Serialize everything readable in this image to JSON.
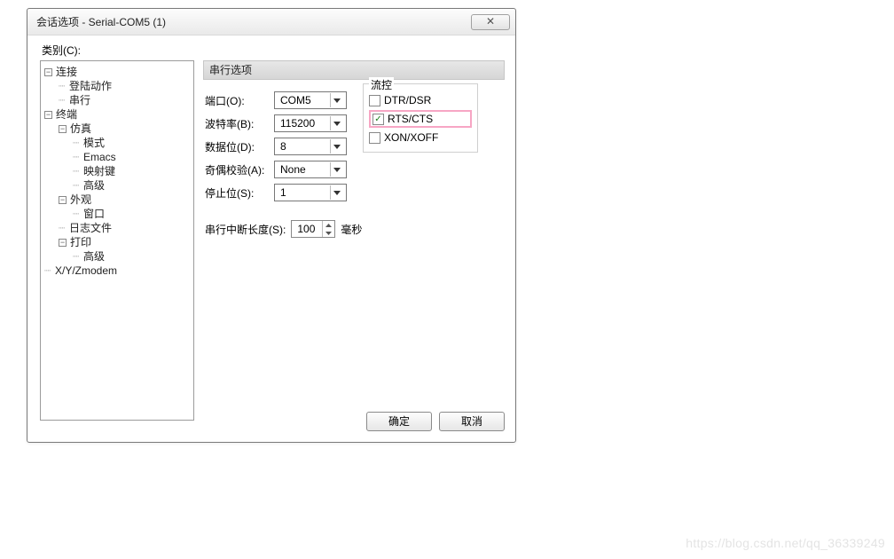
{
  "window": {
    "title": "会话选项 - Serial-COM5 (1)"
  },
  "category_label": "类别(C):",
  "tree": {
    "connection": "连接",
    "connection_children": {
      "login": "登陆动作",
      "serial": "串行"
    },
    "terminal": "终端",
    "emulation": "仿真",
    "emulation_children": {
      "mode": "模式",
      "emacs": "Emacs",
      "mapkeys": "映射键",
      "advanced": "高级"
    },
    "appearance": "外观",
    "appearance_children": {
      "window": "窗口"
    },
    "logfile": "日志文件",
    "print": "打印",
    "print_children": {
      "advanced": "高级"
    },
    "xyzmodem": "X/Y/Zmodem"
  },
  "section": {
    "title": "串行选项"
  },
  "fields": {
    "port_label": "端口(O):",
    "port_value": "COM5",
    "baud_label": "波特率(B):",
    "baud_value": "115200",
    "databits_label": "数据位(D):",
    "databits_value": "8",
    "parity_label": "奇偶校验(A):",
    "parity_value": "None",
    "stopbits_label": "停止位(S):",
    "stopbits_value": "1"
  },
  "flow": {
    "legend": "流控",
    "dtr": "DTR/DSR",
    "rts": "RTS/CTS",
    "xon": "XON/XOFF",
    "dtr_checked": false,
    "rts_checked": true,
    "xon_checked": false
  },
  "serial_break": {
    "label": "串行中断长度(S):",
    "value": "100",
    "unit": "毫秒"
  },
  "buttons": {
    "ok": "确定",
    "cancel": "取消"
  },
  "watermark": "https://blog.csdn.net/qq_36339249"
}
